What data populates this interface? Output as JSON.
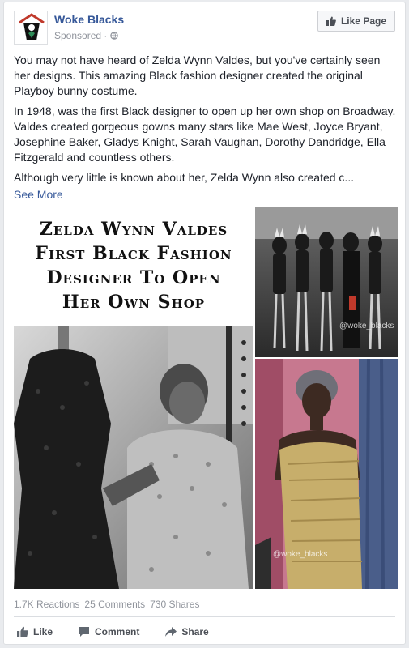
{
  "post": {
    "page_name": "Woke Blacks",
    "sponsored_label": "Sponsored ·",
    "like_page_label": "Like Page",
    "paragraphs": [
      "You may not have heard of Zelda Wynn Valdes, but you've certainly seen her designs. This amazing Black fashion designer created the original Playboy bunny costume.",
      "In 1948, was the first Black designer to open up her own shop on Broadway. Valdes created gorgeous gowns many stars like Mae West, Joyce Bryant, Josephine Baker, Gladys Knight, Sarah Vaughan, Dorothy Dandridge, Ella Fitzgerald and countless others.",
      "Although very little is known about her, Zelda Wynn also created c..."
    ],
    "see_more_label": "See More",
    "image": {
      "headline_lines": [
        "Zelda Wynn Valdes",
        "First Black Fashion",
        "Designer To Open",
        "Her Own Shop"
      ],
      "watermark": "@woke_blacks"
    },
    "stats": {
      "reactions": "1.7K Reactions",
      "comments": "25 Comments",
      "shares": "730 Shares"
    },
    "actions": {
      "like_label": "Like",
      "comment_label": "Comment",
      "share_label": "Share"
    }
  },
  "icons": {
    "like": "thumbs-up-icon",
    "comment": "speech-bubble-icon",
    "share": "share-arrow-icon",
    "privacy": "globe-icon"
  },
  "colors": {
    "link": "#365899",
    "meta": "#90949c",
    "text": "#1d2129"
  }
}
